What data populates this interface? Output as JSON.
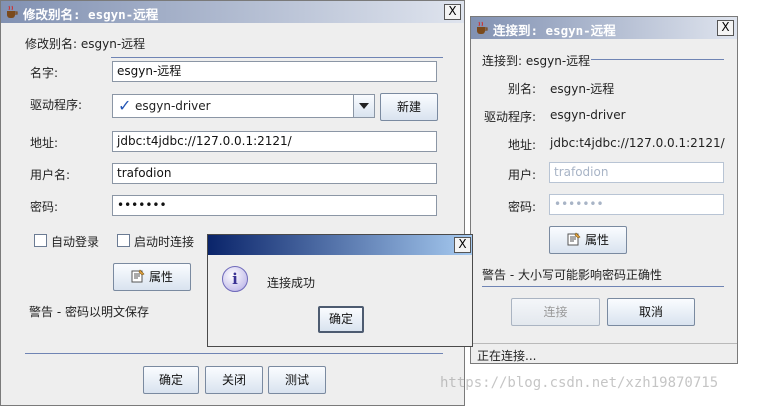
{
  "left_dialog": {
    "title": "修改别名: esgyn-远程",
    "close_glyph": "X",
    "header": "修改别名: esgyn-远程",
    "name_label": "名字:",
    "name_value": "esgyn-远程",
    "driver_label": "驱动程序:",
    "driver_value": "esgyn-driver",
    "new_button": "新建",
    "address_label": "地址:",
    "address_value": "jdbc:t4jdbc://127.0.0.1:2121/",
    "user_label": "用户名:",
    "user_value": "trafodion",
    "password_label": "密码:",
    "password_value": "•••••••",
    "auto_login": "自动登录",
    "connect_on_start": "启动时连接",
    "properties_button": "属性",
    "warning": "警告 - 密码以明文保存",
    "ok_button": "确定",
    "close_button": "关闭",
    "test_button": "测试"
  },
  "right_dialog": {
    "title": "连接到: esgyn-远程",
    "close_glyph": "X",
    "header": "连接到: esgyn-远程",
    "alias_label": "别名:",
    "alias_value": "esgyn-远程",
    "driver_label": "驱动程序:",
    "driver_value": "esgyn-driver",
    "address_label": "地址:",
    "address_value": "jdbc:t4jdbc://127.0.0.1:2121/",
    "user_label": "用户:",
    "user_value": "trafodion",
    "password_label": "密码:",
    "password_value": "•••••••",
    "properties_button": "属性",
    "warning": "警告 - 大小写可能影响密码正确性",
    "connect_button": "连接",
    "cancel_button": "取消",
    "status": "正在连接..."
  },
  "message_dialog": {
    "close_glyph": "X",
    "message": "连接成功",
    "ok_button": "确定"
  },
  "watermark": "https://blog.csdn.net/xzh19870715",
  "icons": {
    "app": "coffee-cup-icon",
    "info": "info-icon",
    "properties": "properties-icon",
    "driver_check": "checkmark-icon"
  },
  "colors": {
    "titlebar_start": "#8191b2",
    "message_titlebar": "#0a246a",
    "separator": "#6f84b4"
  }
}
